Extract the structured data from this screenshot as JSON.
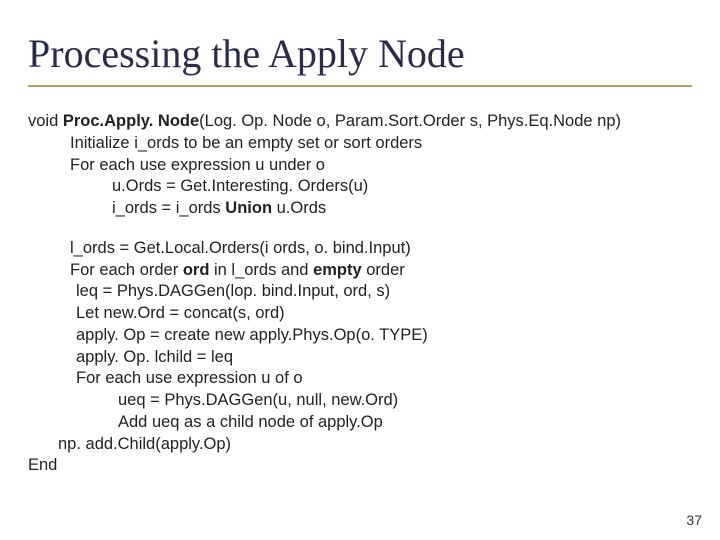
{
  "title": "Processing the Apply Node",
  "line1_pre": "void ",
  "line1_bold": "Proc.Apply. Node",
  "line1_post": "(Log. Op. Node o, Param.Sort.Order s, Phys.Eq.Node np)",
  "line2": "Initialize i_ords to be an empty set or sort orders",
  "line3": "For each use expression u under o",
  "line4": "u.Ords = Get.Interesting. Orders(u)",
  "line5_pre": "i_ords = i_ords ",
  "line5_bold": "Union",
  "line5_post": " u.Ords",
  "line6": "l_ords = Get.Local.Orders(i ords, o. bind.Input)",
  "line7_pre": "For each order ",
  "line7_bold": "ord",
  "line7_post": " in l_ords and ",
  "line7_bold2": "empty",
  "line7_post2": " order",
  "line8": "leq = Phys.DAGGen(lop. bind.Input, ord, s)",
  "line9": "Let new.Ord = concat(s, ord)",
  "line10": "apply. Op = create new apply.Phys.Op(o. TYPE)",
  "line11": "apply. Op. lchild = leq",
  "line12": "For each use expression u of o",
  "line13": "ueq = Phys.DAGGen(u, null, new.Ord)",
  "line14": "Add ueq as a child node of apply.Op",
  "line15": "np. add.Child(apply.Op)",
  "line16": "End",
  "page_number": "37"
}
